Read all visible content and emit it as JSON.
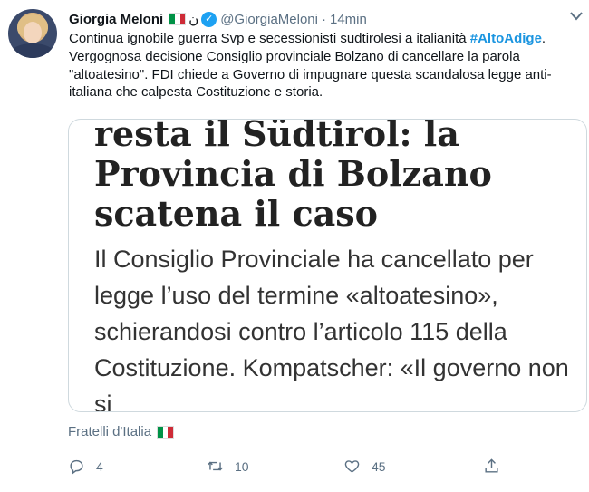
{
  "tweet": {
    "author_name": "Giorgia Meloni",
    "author_extra": "ن",
    "handle": "@GiorgiaMeloni",
    "separator": "·",
    "time": "14min",
    "text_part1": "Continua ignobile guerra Svp e secessionisti sudtirolesi a italianità ",
    "hashtag": "#AltoAdige",
    "text_part2": ". Vergognosa decisione Consiglio provinciale Bolzano di cancellare la parola \"altoatesino\". FDI chiede a Governo di impugnare questa scandalosa legge anti-italiana che calpesta Costituzione e storia.",
    "source": "Fratelli d'Italia"
  },
  "media": {
    "headline": "resta il Südtirol: la\nProvincia di Bolzano\nscatena il caso",
    "subtext": "Il Consiglio Provinciale ha cancellato per\nlegge l’uso del termine «altoatesino»,\nschierandosi contro l’articolo 115 della\nCostituzione. Kompatscher: «Il governo non si\npermetterà di impugnare questa legge»"
  },
  "actions": {
    "reply_count": "4",
    "retweet_count": "10",
    "like_count": "45"
  },
  "icons": {
    "avatar": "profile-photo",
    "verified": "verified-badge-icon",
    "flag": "italy-flag-icon",
    "more": "chevron-down-icon",
    "reply": "reply-icon",
    "retweet": "retweet-icon",
    "like": "heart-icon",
    "share": "share-icon"
  },
  "colors": {
    "accent": "#1b95e0",
    "verified": "#1da1f2",
    "muted": "#5b7083"
  }
}
